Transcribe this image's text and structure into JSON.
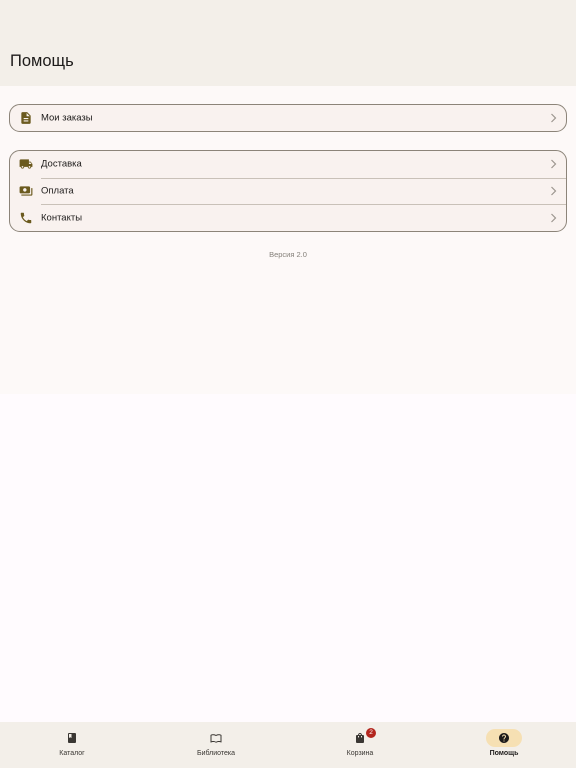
{
  "header": {
    "title": "Помощь"
  },
  "orders": {
    "label": "Мои заказы"
  },
  "info": {
    "items": [
      {
        "label": "Доставка",
        "icon": "truck-icon"
      },
      {
        "label": "Оплата",
        "icon": "payments-icon"
      },
      {
        "label": "Контакты",
        "icon": "phone-icon"
      }
    ]
  },
  "version": "Версия 2.0",
  "nav": {
    "items": [
      {
        "label": "Каталог",
        "icon": "book-icon"
      },
      {
        "label": "Библиотека",
        "icon": "open-book-icon"
      },
      {
        "label": "Корзина",
        "icon": "shopping-bag-icon",
        "badge": "2"
      },
      {
        "label": "Помощь",
        "icon": "help-circle-icon",
        "active": true
      }
    ]
  },
  "colors": {
    "accent_icon": "#6b5a1e",
    "active_pill": "#f6e0b3",
    "badge": "#b3261e",
    "topbar_bg": "#f3efe9"
  }
}
